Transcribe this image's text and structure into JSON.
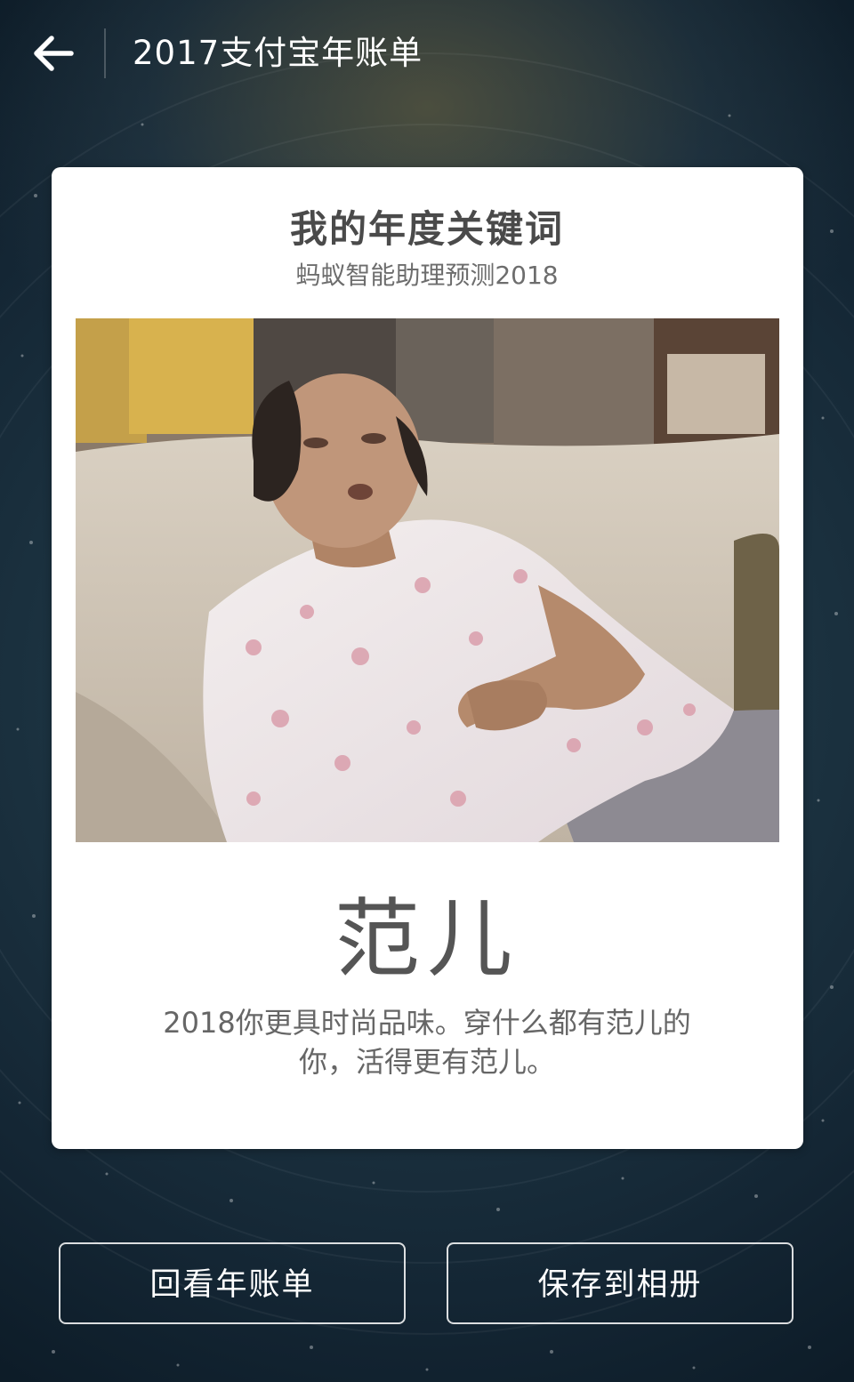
{
  "header": {
    "title": "2017支付宝年账单",
    "back_icon": "arrow-left-icon"
  },
  "card": {
    "title": "我的年度关键词",
    "subtitle": "蚂蚁智能助理预测2018",
    "keyword": "范儿",
    "description_line1": "2018你更具时尚品味。穿什么都有范儿的",
    "description_line2": "你，活得更有范儿。"
  },
  "buttons": {
    "review_label": "回看年账单",
    "save_label": "保存到相册"
  },
  "colors": {
    "background": "#1c3341",
    "card": "#ffffff",
    "title_text": "#4a4a4a",
    "keyword_text": "#555555"
  }
}
